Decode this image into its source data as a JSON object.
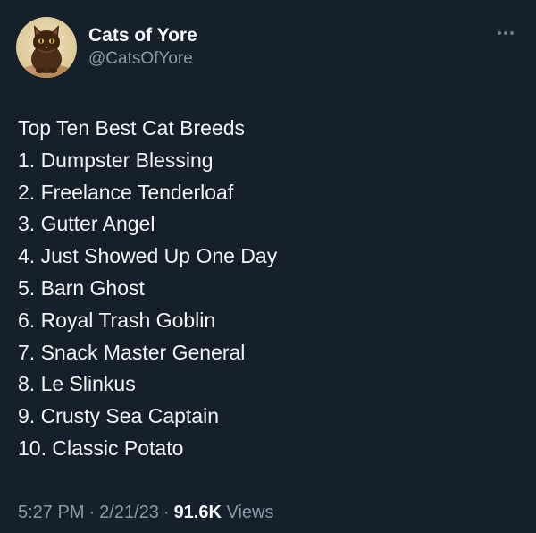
{
  "author": {
    "display_name": "Cats of Yore",
    "handle": "@CatsOfYore"
  },
  "icons": {
    "avatar": "cat-illustration-avatar",
    "more": "more-horizontal-icon"
  },
  "tweet": {
    "lines": [
      "Top Ten Best Cat Breeds",
      "1. Dumpster Blessing",
      "2. Freelance Tenderloaf",
      "3. Gutter Angel",
      "4. Just Showed Up One Day",
      "5. Barn Ghost",
      "6. Royal Trash Goblin",
      "7. Snack Master General",
      "8. Le Slinkus",
      "9. Crusty Sea Captain",
      "10. Classic Potato"
    ]
  },
  "meta": {
    "time": "5:27 PM",
    "date": "2/21/23",
    "separator": "·",
    "views_count": "91.6K",
    "views_label": "Views"
  },
  "colors": {
    "background": "#15202b",
    "primary_text": "#f2f4f5",
    "secondary_text": "#8b98a5"
  }
}
